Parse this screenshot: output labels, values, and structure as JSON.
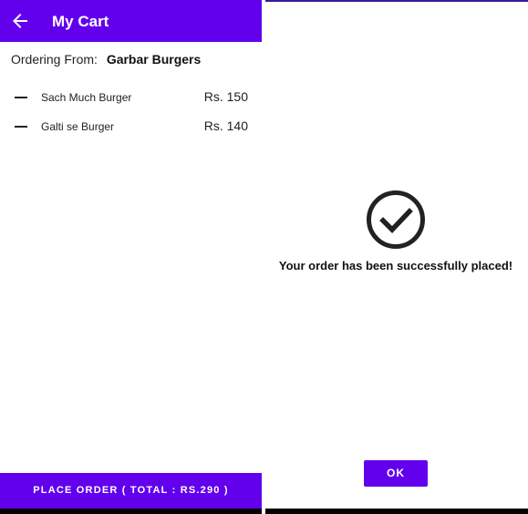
{
  "cart_screen": {
    "title": "My Cart",
    "back_icon": "arrow-left-icon",
    "ordering_from_label": "Ordering From:",
    "restaurant_name": "Garbar Burgers",
    "items": [
      {
        "name": "Sach Much Burger",
        "price": "Rs. 150"
      },
      {
        "name": "Galti se Burger",
        "price": "Rs. 140"
      }
    ],
    "place_order_label": "PLACE ORDER ( TOTAL : RS.290 )"
  },
  "success_dialog": {
    "icon": "check-circle-icon",
    "message": "Your order has been successfully placed!",
    "ok_label": "OK"
  },
  "colors": {
    "primary": "#6200ee",
    "background": "#ffffff",
    "text": "#222222",
    "nav_bar": "#000000"
  }
}
